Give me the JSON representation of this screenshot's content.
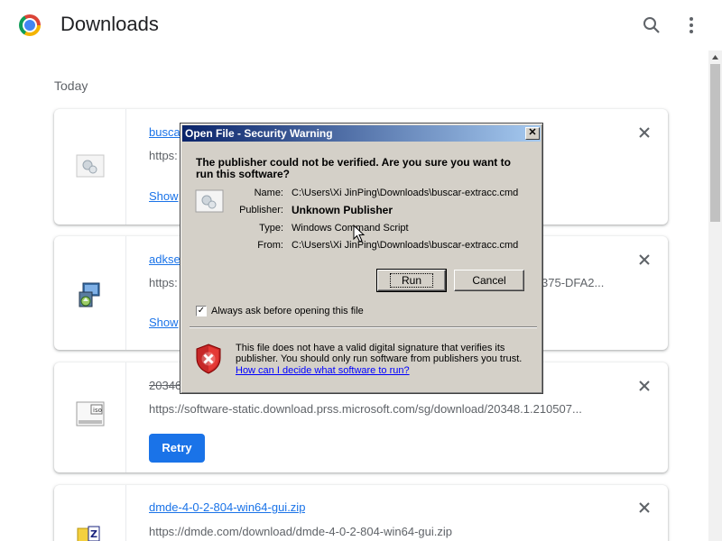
{
  "header": {
    "title": "Downloads",
    "logo": "chrome-logo-icon"
  },
  "date_label": "Today",
  "downloads": [
    {
      "name": "busca",
      "url": "https:",
      "action": "Show",
      "icon": "cmd-file-icon"
    },
    {
      "name": "adkse",
      "url": "https:",
      "url_tail": "375-DFA2...",
      "action": "Show",
      "icon": "installer-icon"
    },
    {
      "name": "20346",
      "url": "https://software-static.download.prss.microsoft.com/sg/download/20348.1.210507...",
      "action": "Retry",
      "icon": "iso-icon"
    },
    {
      "name": "dmde-4-0-2-804-win64-gui.zip",
      "url": "https://dmde.com/download/dmde-4-0-2-804-win64-gui.zip",
      "icon": "zip-icon"
    }
  ],
  "dialog": {
    "title": "Open File - Security Warning",
    "question": "The publisher could not be verified.  Are you sure you want to run this software?",
    "labels": {
      "name": "Name:",
      "publisher": "Publisher:",
      "type": "Type:",
      "from": "From:"
    },
    "values": {
      "name": "C:\\Users\\Xi JinPing\\Downloads\\buscar-extracc.cmd",
      "publisher": "Unknown Publisher",
      "type": "Windows Command Script",
      "from": "C:\\Users\\Xi JinPing\\Downloads\\buscar-extracc.cmd"
    },
    "run_label": "Run",
    "cancel_label": "Cancel",
    "always_ask_label": "Always ask before opening this file",
    "always_ask_checked": true,
    "warning_text": "This file does not have a valid digital signature that verifies its publisher.  You should only run software from publishers you trust.",
    "help_link": "How can I decide what software to run?",
    "close_glyph": "✕"
  },
  "colors": {
    "link": "#1a73e8",
    "retry_bg": "#1a73e8",
    "dialog_bg": "#d4d0c8",
    "titlebar": "#0a246a"
  }
}
